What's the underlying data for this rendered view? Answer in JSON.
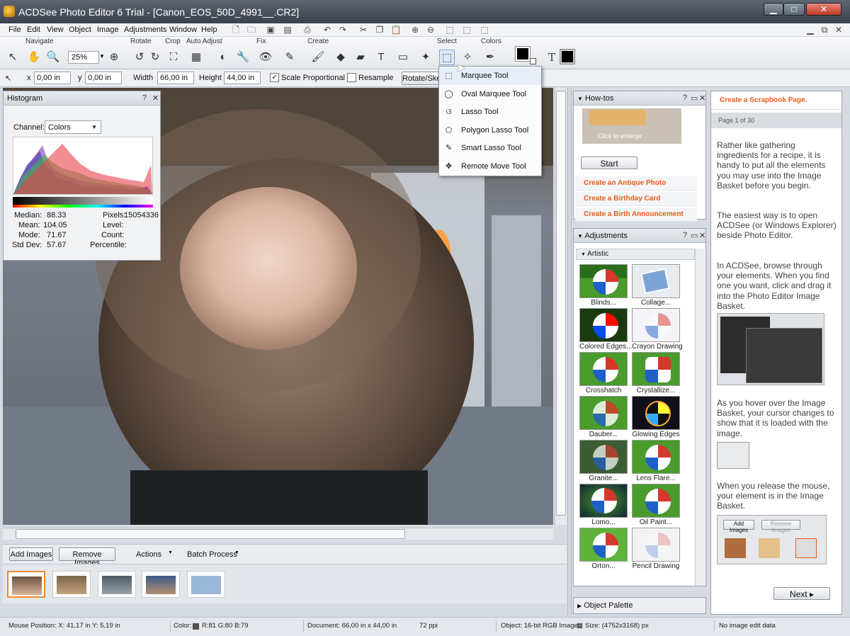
{
  "window": {
    "title": "ACDSee Photo Editor 6 Trial - [Canon_EOS_50D_4991__.CR2]",
    "min_icon": "minimize-icon",
    "max_icon": "maximize-icon",
    "close_icon": "close-icon"
  },
  "menu": [
    "File",
    "Edit",
    "View",
    "Object",
    "Image",
    "Adjustments",
    "Window",
    "Help"
  ],
  "toolbar": {
    "groups": [
      "Navigate",
      "Rotate",
      "Crop",
      "Auto Adjust",
      "Fix",
      "Create",
      "Select",
      "Colors"
    ],
    "zoom": "25%",
    "text_tool": "T"
  },
  "props": {
    "x_label": "x",
    "x_value": "0,00 in",
    "y_label": "y",
    "y_value": "0,00 in",
    "width_label": "Width",
    "width_value": "66,00 in",
    "height_label": "Height",
    "height_value": "44,00 in",
    "scale_label": "Scale Proportional",
    "scale_checked": "✓",
    "resample_label": "Resample",
    "rotate_label": "Rotate/Ske"
  },
  "histogram": {
    "title": "Histogram",
    "channel_label": "Channel:",
    "channel_value": "Colors",
    "help": "?",
    "close": "✕",
    "median_label": "Median:",
    "median": "88.33",
    "mean_label": "Mean:",
    "mean": "104.05",
    "mode_label": "Mode:",
    "mode": "71.67",
    "std_label": "Std Dev:",
    "std": "57.67",
    "pixels_label": "Pixels:",
    "pixels": "15054336",
    "level_label": "Level:",
    "count_label": "Count:",
    "percentile_label": "Percentile:"
  },
  "select_menu": [
    {
      "label": "Marquee Tool",
      "icon": "marquee-icon"
    },
    {
      "label": "Oval Marquee Tool",
      "icon": "oval-marquee-icon"
    },
    {
      "label": "Lasso Tool",
      "icon": "lasso-icon"
    },
    {
      "label": "Polygon Lasso Tool",
      "icon": "polygon-lasso-icon"
    },
    {
      "label": "Smart Lasso Tool",
      "icon": "smart-lasso-icon"
    },
    {
      "label": "Remote Move Tool",
      "icon": "move-icon"
    }
  ],
  "howtos": {
    "title": "How-tos",
    "enlarge": "Click to enlarge",
    "start": "Start",
    "links": [
      "Create an Antique Photo",
      "Create a Birthday Card",
      "Create a Birth Announcement"
    ]
  },
  "adjustments": {
    "title": "Adjustments",
    "category": "Artistic",
    "effects": [
      "Blinds...",
      "Collage...",
      "Colored Edges...",
      "Crayon Drawing",
      "Crosshatch",
      "Crystallize...",
      "Dauber...",
      "Glowing Edges",
      "Granite...",
      "Lens Flare...",
      "Lomo...",
      "Oil Paint...",
      "Orton...",
      "Pencil Drawing"
    ]
  },
  "object_palette": {
    "title": "Object Palette"
  },
  "scrapbook": {
    "title": "Create a Scrapbook Page.",
    "page": "Page 1 of 30",
    "p1": "Rather like gathering ingredients for a recipe, it is handy to put all the elements you may use into the Image Basket before you begin.",
    "p2": "The easiest way is to open ACDSee (or Windows Explorer) beside Photo Editor.",
    "p3": "In ACDSee, browse through your elements. When you find one you want, click and drag it into the Photo Editor Image Basket.",
    "p4": "As you hover over the Image Basket, your cursor changes to show that it is loaded with the image.",
    "p5": "When you release the mouse, your element is in the Image Basket.",
    "add_images": "Add Images",
    "remove_images": "Remove Images",
    "next": "Next"
  },
  "basket": {
    "add": "Add Images",
    "remove": "Remove Images",
    "actions": "Actions",
    "batch": "Batch Process"
  },
  "status": {
    "mouse": "Mouse Position: X: 41,17 in   Y: 5,19 in",
    "color_label": "Color:",
    "color": "R:81  G:80  B:79",
    "document": "Document: 66,00 in x 44,00 in",
    "ppi": "72 ppi",
    "object": "Object: 16-bit RGB Image",
    "size": "Size: (4752x3168) px",
    "edit": "No image edit data"
  }
}
